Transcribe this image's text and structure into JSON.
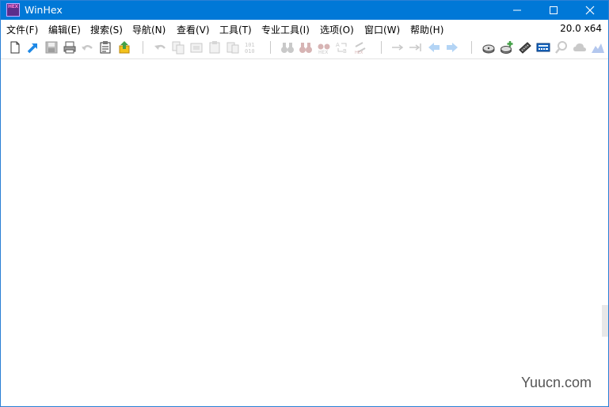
{
  "window": {
    "title": "WinHex",
    "icon_text": "HEX",
    "controls": {
      "minimize": "minimize-icon",
      "maximize": "maximize-icon",
      "close": "close-icon"
    }
  },
  "menu": {
    "items": [
      "文件(F)",
      "编辑(E)",
      "搜索(S)",
      "导航(N)",
      "查看(V)",
      "工具(T)",
      "专业工具(I)",
      "选项(O)",
      "窗口(W)",
      "帮助(H)"
    ],
    "version": "20.0 x64"
  },
  "toolbar": {
    "icons": [
      "new-file",
      "open",
      "save",
      "print",
      "undo-disabled",
      "properties",
      "export",
      "undo",
      "copy",
      "cut-copy",
      "paste",
      "paste-special",
      "binary",
      "find",
      "find-hex",
      "find-hex-2",
      "replace",
      "replace-hex",
      "goto",
      "goto-offset",
      "back",
      "forward",
      "open-disk",
      "add-disk",
      "ram",
      "calculator",
      "magnify",
      "cloud",
      "chart"
    ]
  },
  "watermark": {
    "text": "Yuucn.com"
  },
  "colors": {
    "titlebar": "#0078d7",
    "accent": "#1e88e5"
  }
}
